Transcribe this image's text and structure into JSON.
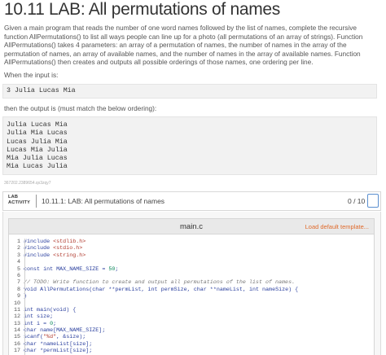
{
  "page": {
    "title": "10.11 LAB: All permutations of names",
    "description": "Given a main program that reads the number of one word names followed by the list of names, complete the recursive function AllPermutations() to list all ways people can line up for a photo (all permutations of an array of strings). Function AllPermutations() takes 4 parameters: an array of a permutation of names, the number of names in the array of the permutation of names, an array of available names, and the number of names in the array of available names. Function AllPermutations() then creates and outputs all possible orderings of those names, one ordering per line.",
    "input_label": "When the input is:",
    "input_lines": [
      "3 Julia Lucas Mia"
    ],
    "output_label": "then the output is (must match the below ordering):",
    "output_lines": [
      "Julia Lucas Mia",
      "Julia Mia Lucas",
      "Lucas Julia Mia",
      "Lucas Mia Julia",
      "Mia Julia Lucas",
      "Mia Lucas Julia"
    ],
    "small_id": "367202.2389654.qx3zqy7"
  },
  "lab": {
    "tag_line1": "LAB",
    "tag_line2": "ACTIVITY",
    "title": "10.11.1: LAB: All permutations of names",
    "score": "0 / 10"
  },
  "editor": {
    "file_name": "main.c",
    "load_template_label": "Load default template...",
    "code_lines": [
      "#include <stdlib.h>",
      "#include <stdio.h>",
      "#include <string.h>",
      "",
      "const int MAX_NAME_SIZE = 50;",
      "",
      "// TODO: Write function to create and output all permutations of the list of names.",
      "void AllPermutations(char **permList, int permSize, char **nameList, int nameSize) {",
      "}",
      "",
      "int main(void) {",
      "int size;",
      "int i = 0;",
      "char name[MAX_NAME_SIZE];",
      "scanf(\"%d\", &size);",
      "char *nameList[size];",
      "char *permList[size];"
    ]
  },
  "colors": {
    "accent_orange": "#e06b2d",
    "score_icon_blue": "#5b8fd0",
    "keyword_blue": "#2a3f9e"
  }
}
